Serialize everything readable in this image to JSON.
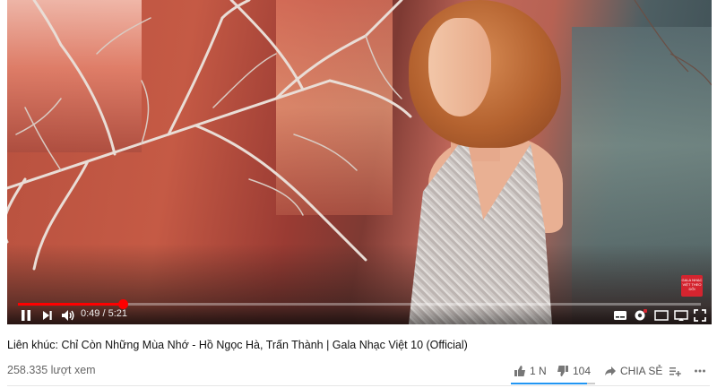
{
  "player": {
    "current_time": "0:49",
    "separator": "/",
    "duration": "5:21",
    "progress_fraction": 0.153,
    "watermark": "GALA NHẠC VIỆT THEO DÕI"
  },
  "video": {
    "title": "Liên khúc: Chỉ Còn Những Mùa Nhớ - Hồ Ngọc Hà, Trấn Thành | Gala Nhạc Việt 10 (Official)",
    "views": "258.335 lượt xem",
    "likes": "1 N",
    "dislikes": "104",
    "share_label": "CHIA SẺ",
    "like_ratio": 0.9
  },
  "colors": {
    "progress": "#ff0000",
    "like_bar": "#2196f3"
  },
  "icons": [
    "pause-icon",
    "next-icon",
    "volume-icon",
    "subtitles-icon",
    "settings-icon",
    "miniplayer-icon",
    "theater-icon",
    "cast-icon",
    "fullscreen-icon",
    "thumbs-up-icon",
    "thumbs-down-icon",
    "share-icon",
    "add-to-playlist-icon",
    "more-icon"
  ]
}
